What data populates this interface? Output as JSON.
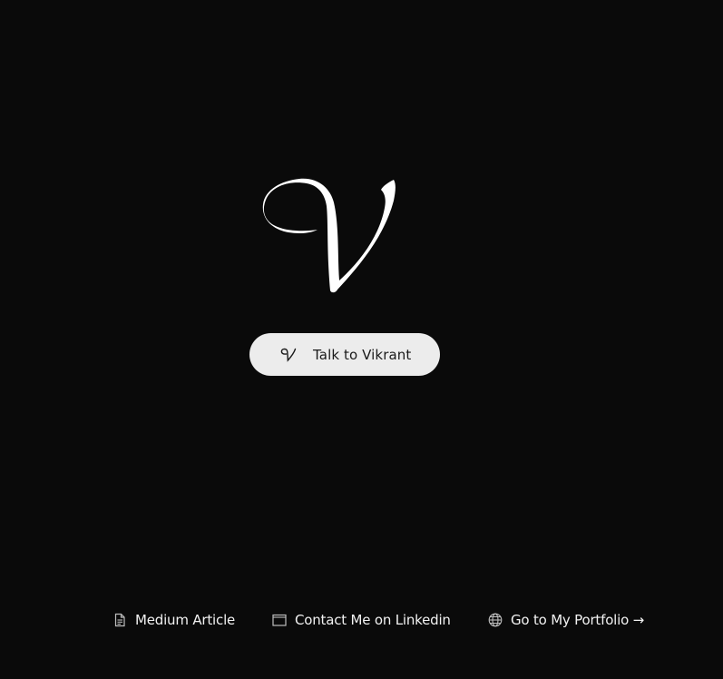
{
  "colors": {
    "background": "#0a0a0a",
    "button_bg": "#ececec",
    "button_text": "#1a1a1a",
    "footer_text": "#f2f2f2",
    "icon_stroke": "#bdbdbd"
  },
  "hero": {
    "logo_icon": "script-v-logo-icon",
    "cta": {
      "icon": "script-v-logo-icon",
      "label": "Talk to Vikrant"
    }
  },
  "footer": {
    "links": [
      {
        "icon": "document-icon",
        "label": "Medium Article"
      },
      {
        "icon": "window-icon",
        "label": "Contact Me on Linkedin"
      },
      {
        "icon": "globe-icon",
        "label": "Go to My Portfolio →"
      }
    ]
  }
}
